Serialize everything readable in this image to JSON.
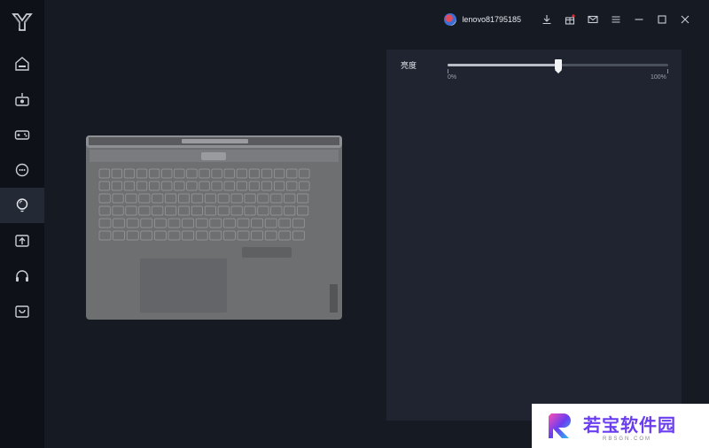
{
  "app": {
    "name": "Lenovo Legion"
  },
  "topbar": {
    "username": "lenovo81795185"
  },
  "sidebar": {
    "items": [
      {
        "icon": "home-icon"
      },
      {
        "icon": "device-icon"
      },
      {
        "icon": "gamepad-icon"
      },
      {
        "icon": "chat-icon"
      },
      {
        "icon": "lightbulb-icon",
        "active": true
      },
      {
        "icon": "upload-icon"
      },
      {
        "icon": "headset-icon"
      },
      {
        "icon": "store-icon"
      }
    ]
  },
  "panel": {
    "brightness_label": "亮度",
    "brightness_value": 0.5,
    "min_label": "0%",
    "max_label": "100%"
  },
  "watermark": {
    "title": "若宝软件园",
    "subtitle": "RBSGN.COM"
  },
  "colors": {
    "sidebar_bg": "#0e1117",
    "main_bg": "#161b23",
    "panel_bg": "#1f2430",
    "accent": "#f2f3f5"
  }
}
